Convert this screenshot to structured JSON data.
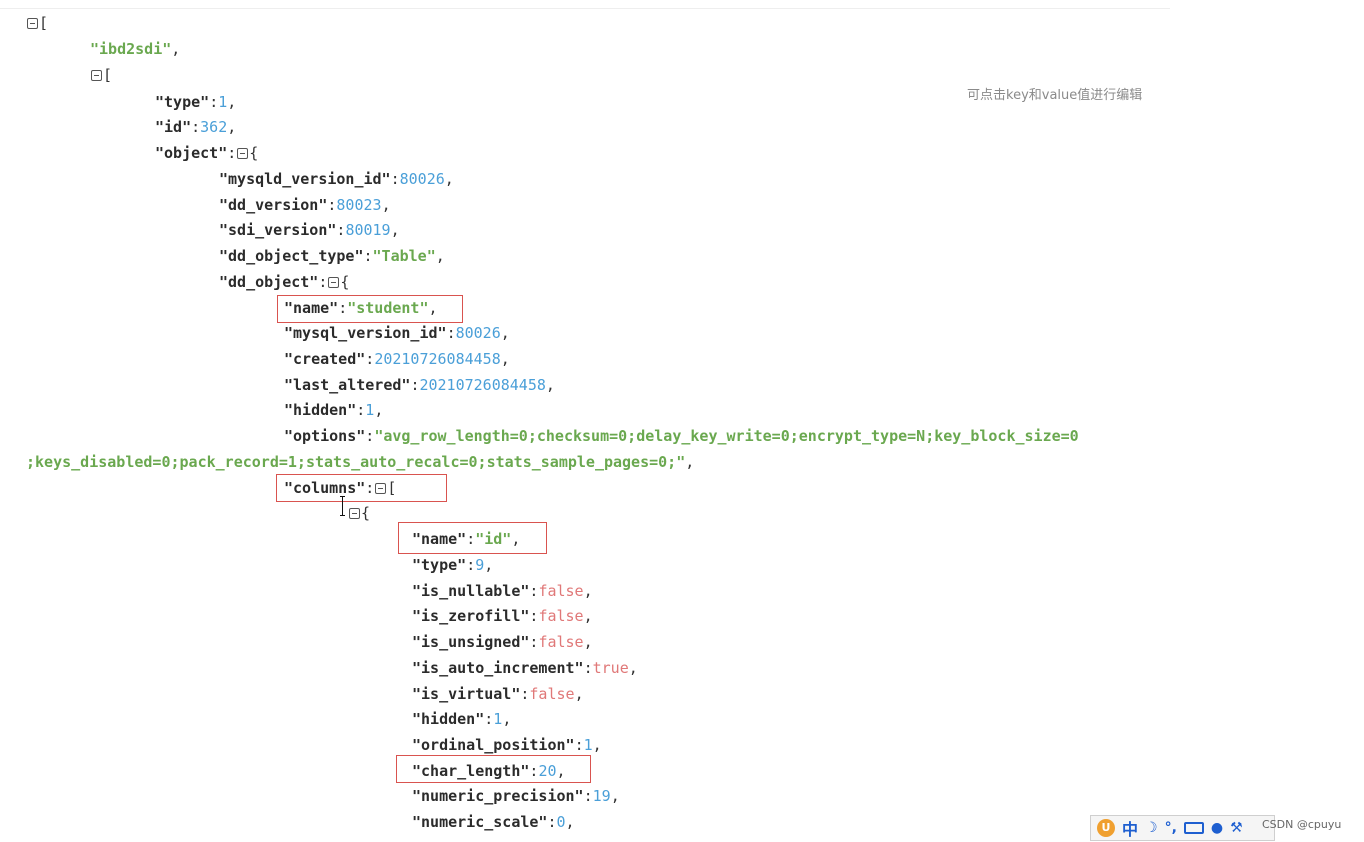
{
  "hint": "可点击key和value值进行编辑",
  "json": {
    "root_open": "[",
    "ibd2sdi_str": "\"ibd2sdi\"",
    "open_bracket": "[",
    "open_brace": "{",
    "comma": ",",
    "colon": ":",
    "type_key": "\"type\"",
    "type_val": "1",
    "id_key": "\"id\"",
    "id_val": "362",
    "object_key": "\"object\"",
    "mysqld_version_id_key": "\"mysqld_version_id\"",
    "mysqld_version_id_val": "80026",
    "dd_version_key": "\"dd_version\"",
    "dd_version_val": "80023",
    "sdi_version_key": "\"sdi_version\"",
    "sdi_version_val": "80019",
    "dd_object_type_key": "\"dd_object_type\"",
    "dd_object_type_val": "\"Table\"",
    "dd_object_key": "\"dd_object\"",
    "name_key": "\"name\"",
    "name_val": "\"student\"",
    "mysql_version_id_key": "\"mysql_version_id\"",
    "mysql_version_id_val": "80026",
    "created_key": "\"created\"",
    "created_val": "20210726084458",
    "last_altered_key": "\"last_altered\"",
    "last_altered_val": "20210726084458",
    "hidden_key": "\"hidden\"",
    "hidden_val": "1",
    "options_key": "\"options\"",
    "options_val_1": "\"avg_row_length=0;checksum=0;delay_key_write=0;encrypt_type=N;key_block_size=0",
    "options_val_2": ";keys_disabled=0;pack_record=1;stats_auto_recalc=0;stats_sample_pages=0;\"",
    "columns_key": "\"columns\"",
    "col_name_key": "\"name\"",
    "col_name_val": "\"id\"",
    "col_type_key": "\"type\"",
    "col_type_val": "9",
    "is_nullable_key": "\"is_nullable\"",
    "is_nullable_val": "false",
    "is_zerofill_key": "\"is_zerofill\"",
    "is_zerofill_val": "false",
    "is_unsigned_key": "\"is_unsigned\"",
    "is_unsigned_val": "false",
    "is_auto_increment_key": "\"is_auto_increment\"",
    "is_auto_increment_val": "true",
    "is_virtual_key": "\"is_virtual\"",
    "is_virtual_val": "false",
    "col_hidden_key": "\"hidden\"",
    "col_hidden_val": "1",
    "ordinal_position_key": "\"ordinal_position\"",
    "ordinal_position_val": "1",
    "char_length_key": "\"char_length\"",
    "char_length_val": "20",
    "numeric_precision_key": "\"numeric_precision\"",
    "numeric_precision_val": "19",
    "numeric_scale_key": "\"numeric_scale\"",
    "numeric_scale_val": "0"
  },
  "ime": {
    "logo": "U",
    "mode": "中",
    "moon": "☽",
    "punct": "°,",
    "user_icon": "user-icon",
    "tool_icon": "wrench-icon"
  },
  "watermark": "CSDN @cpuyu"
}
